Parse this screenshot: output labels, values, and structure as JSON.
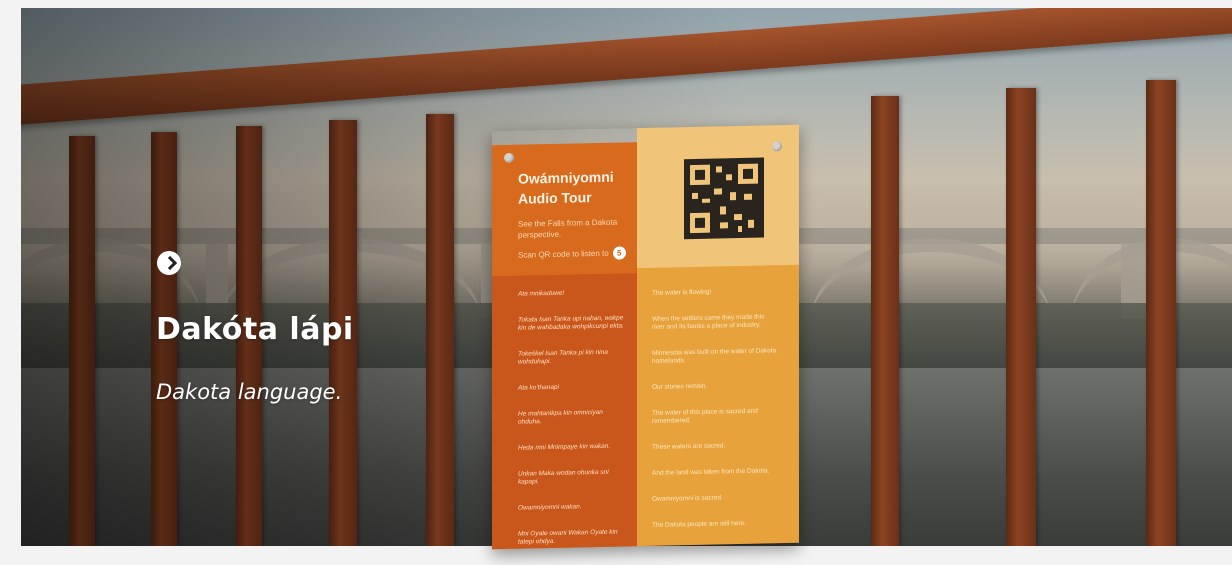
{
  "hero": {
    "title": "Dakóta lápi",
    "subtitle": "Dakota language.",
    "arrow_icon": "chevron-right-circle-icon"
  },
  "sign": {
    "title_line1": "Owámniyomni",
    "title_line2": "Audio Tour",
    "description": "See the Falls from a Dakota perspective.",
    "scan_text": "Scan QR code to listen to",
    "scan_number": "5",
    "dakota_lines": [
      "Ata mnikaduwe!",
      "Tokata Isan Tanka upi nahan, wakpe kin de wahbadaka wohpikcunpi ekta.",
      "Tokeškel Isan Tanka pi kin nina wohduhapi.",
      "Ata ko'thanapi",
      "He mahtanikpa kin omniciyan ohduha.",
      "Heda mni Mnimpaye kin wakan.",
      "Unkan Maka wodan ohunka sni kapapi.",
      "Owamniyomni wakan.",
      "Mni Oyate owani Wakan Oyate kin tatepi ohdya."
    ],
    "english_lines": [
      "The water is flowing!",
      "When the settlers came they made this river and its banks a place of industry.",
      "Minnesota was built on the water of Dakota homelands.",
      "Our stories remain.",
      "The water of this place is sacred and remembered.",
      "These waters are sacred.",
      "And the land was taken from the Dakota.",
      "Owamniyomni is sacred.",
      "The Dakota people are still here."
    ]
  }
}
